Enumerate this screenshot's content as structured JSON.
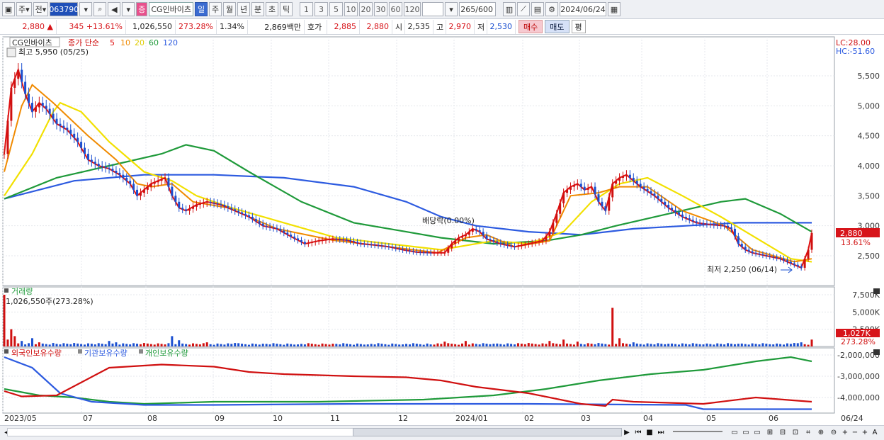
{
  "toolbar": {
    "mode_stock": "주",
    "prev": "전",
    "code": "063790",
    "stock_badge": "증",
    "stock_name": "CG인바이츠",
    "periods": [
      "일",
      "주",
      "월",
      "년",
      "분",
      "초",
      "틱"
    ],
    "active_period": "일",
    "intervals": [
      "1",
      "3",
      "5",
      "10",
      "20",
      "30",
      "60",
      "120"
    ],
    "count": "265",
    "count_max": "/600",
    "date": "2024/06/24"
  },
  "infobar": {
    "price": "2,880 ▲",
    "change": "345 +13.61%",
    "volume": "1,026,550",
    "vol_ratio": "273.28%",
    "turnover": "1.34%",
    "amount": "2,869백만",
    "quote_label": "호가",
    "ask": "2,885",
    "bid": "2,880",
    "open_label": "시",
    "open": "2,535",
    "high_label": "고",
    "high": "2,970",
    "low_label": "저",
    "low": "2,530",
    "buy": "매수",
    "sell": "매도",
    "even": "평"
  },
  "price_panel": {
    "name": "CG인바이츠",
    "legend_prefix": "종가 단순",
    "ma": [
      {
        "label": "5",
        "color": "#e01010"
      },
      {
        "label": "10",
        "color": "#f08a00"
      },
      {
        "label": "20",
        "color": "#f2e000"
      },
      {
        "label": "60",
        "color": "#1f9a3a"
      },
      {
        "label": "120",
        "color": "#2d5be0"
      }
    ],
    "high_note": "최고 5,950 (05/25)",
    "low_note": "최저 2,250 (06/14)",
    "dividend_note": "배당락(0.00%)",
    "lc": "LC:28.00",
    "hc": "HC:-51.60",
    "y_ticks": [
      "5,500",
      "5,000",
      "4,500",
      "4,000",
      "3,500",
      "3,000",
      "2,500"
    ],
    "last_price": "2,880",
    "last_change": "13.61%"
  },
  "volume_panel": {
    "title": "거래량",
    "info": "1,026,550주(273.28%)",
    "y_ticks": [
      "7,500K",
      "5,000K",
      "2,500K"
    ],
    "last_vol": "1,027K",
    "last_ratio": "273.28%"
  },
  "holdings_panel": {
    "legends": [
      {
        "label": "외국인보유수량",
        "color": "#d01010"
      },
      {
        "label": "기관보유수량",
        "color": "#2d5be0"
      },
      {
        "label": "개인보유수량",
        "color": "#1f9a3a"
      }
    ],
    "y_ticks": [
      "-2,000,000",
      "-3,000,000",
      "-4,000,000"
    ]
  },
  "x_axis": [
    "2023/05",
    "07",
    "08",
    "09",
    "10",
    "11",
    "12",
    "2024/01",
    "02",
    "03",
    "04",
    "05",
    "06",
    "06/24"
  ],
  "chart_data": {
    "type": "line",
    "price_range": [
      2200,
      5950
    ],
    "close_path": [
      [
        0,
        4200
      ],
      [
        2,
        5300
      ],
      [
        4,
        5600
      ],
      [
        6,
        5200
      ],
      [
        8,
        4900
      ],
      [
        10,
        5050
      ],
      [
        12,
        4950
      ],
      [
        15,
        4700
      ],
      [
        18,
        4600
      ],
      [
        21,
        4400
      ],
      [
        24,
        4100
      ],
      [
        27,
        4000
      ],
      [
        30,
        3950
      ],
      [
        33,
        3850
      ],
      [
        36,
        3700
      ],
      [
        38,
        3500
      ],
      [
        40,
        3600
      ],
      [
        42,
        3700
      ],
      [
        44,
        3750
      ],
      [
        46,
        3800
      ],
      [
        48,
        3500
      ],
      [
        50,
        3300
      ],
      [
        52,
        3250
      ],
      [
        55,
        3350
      ],
      [
        58,
        3400
      ],
      [
        62,
        3350
      ],
      [
        66,
        3250
      ],
      [
        70,
        3150
      ],
      [
        74,
        3000
      ],
      [
        78,
        2950
      ],
      [
        82,
        2820
      ],
      [
        86,
        2700
      ],
      [
        90,
        2750
      ],
      [
        94,
        2780
      ],
      [
        98,
        2760
      ],
      [
        102,
        2700
      ],
      [
        106,
        2680
      ],
      [
        110,
        2650
      ],
      [
        114,
        2600
      ],
      [
        118,
        2560
      ],
      [
        122,
        2550
      ],
      [
        126,
        2550
      ],
      [
        128,
        2700
      ],
      [
        130,
        2800
      ],
      [
        132,
        2850
      ],
      [
        134,
        2950
      ],
      [
        136,
        2900
      ],
      [
        138,
        2780
      ],
      [
        142,
        2700
      ],
      [
        146,
        2650
      ],
      [
        150,
        2700
      ],
      [
        154,
        2750
      ],
      [
        156,
        2900
      ],
      [
        158,
        3200
      ],
      [
        160,
        3550
      ],
      [
        162,
        3650
      ],
      [
        164,
        3700
      ],
      [
        166,
        3600
      ],
      [
        168,
        3650
      ],
      [
        170,
        3400
      ],
      [
        172,
        3250
      ],
      [
        174,
        3700
      ],
      [
        176,
        3800
      ],
      [
        178,
        3850
      ],
      [
        180,
        3750
      ],
      [
        182,
        3650
      ],
      [
        186,
        3500
      ],
      [
        190,
        3300
      ],
      [
        194,
        3150
      ],
      [
        198,
        3050
      ],
      [
        202,
        3020
      ],
      [
        206,
        3000
      ],
      [
        208,
        2950
      ],
      [
        210,
        2700
      ],
      [
        212,
        2600
      ],
      [
        214,
        2550
      ],
      [
        218,
        2500
      ],
      [
        222,
        2450
      ],
      [
        226,
        2350
      ],
      [
        228,
        2300
      ],
      [
        230,
        2600
      ],
      [
        231,
        2880
      ]
    ],
    "ma120_path": [
      [
        0,
        3450
      ],
      [
        20,
        3750
      ],
      [
        40,
        3850
      ],
      [
        60,
        3850
      ],
      [
        80,
        3800
      ],
      [
        100,
        3650
      ],
      [
        115,
        3400
      ],
      [
        125,
        3150
      ],
      [
        135,
        3000
      ],
      [
        150,
        2900
      ],
      [
        165,
        2850
      ],
      [
        180,
        2950
      ],
      [
        195,
        3000
      ],
      [
        210,
        3050
      ],
      [
        231,
        3050
      ]
    ],
    "ma60_path": [
      [
        0,
        3450
      ],
      [
        15,
        3800
      ],
      [
        30,
        4000
      ],
      [
        45,
        4200
      ],
      [
        52,
        4350
      ],
      [
        60,
        4250
      ],
      [
        70,
        3900
      ],
      [
        85,
        3400
      ],
      [
        100,
        3050
      ],
      [
        115,
        2900
      ],
      [
        125,
        2800
      ],
      [
        140,
        2700
      ],
      [
        155,
        2750
      ],
      [
        165,
        2850
      ],
      [
        175,
        3000
      ],
      [
        190,
        3200
      ],
      [
        205,
        3400
      ],
      [
        212,
        3450
      ],
      [
        222,
        3200
      ],
      [
        231,
        2900
      ]
    ],
    "ma20_path": [
      [
        0,
        3500
      ],
      [
        8,
        4200
      ],
      [
        14,
        4900
      ],
      [
        16,
        5050
      ],
      [
        22,
        4900
      ],
      [
        30,
        4400
      ],
      [
        40,
        3900
      ],
      [
        48,
        3750
      ],
      [
        55,
        3500
      ],
      [
        65,
        3300
      ],
      [
        80,
        3050
      ],
      [
        95,
        2800
      ],
      [
        110,
        2700
      ],
      [
        125,
        2600
      ],
      [
        140,
        2750
      ],
      [
        150,
        2700
      ],
      [
        160,
        2900
      ],
      [
        168,
        3400
      ],
      [
        176,
        3700
      ],
      [
        184,
        3800
      ],
      [
        194,
        3500
      ],
      [
        205,
        3150
      ],
      [
        215,
        2800
      ],
      [
        225,
        2450
      ],
      [
        231,
        2400
      ]
    ],
    "ma10_path": [
      [
        0,
        3900
      ],
      [
        5,
        5000
      ],
      [
        8,
        5350
      ],
      [
        14,
        5050
      ],
      [
        24,
        4500
      ],
      [
        32,
        4100
      ],
      [
        38,
        3700
      ],
      [
        42,
        3650
      ],
      [
        48,
        3700
      ],
      [
        54,
        3400
      ],
      [
        64,
        3300
      ],
      [
        78,
        2950
      ],
      [
        94,
        2760
      ],
      [
        110,
        2650
      ],
      [
        124,
        2550
      ],
      [
        132,
        2800
      ],
      [
        138,
        2850
      ],
      [
        146,
        2650
      ],
      [
        156,
        2750
      ],
      [
        162,
        3500
      ],
      [
        170,
        3550
      ],
      [
        176,
        3650
      ],
      [
        184,
        3650
      ],
      [
        194,
        3250
      ],
      [
        206,
        3000
      ],
      [
        214,
        2600
      ],
      [
        226,
        2400
      ],
      [
        231,
        2450
      ]
    ],
    "volume": [
      [
        0,
        7.5
      ],
      [
        1,
        1.0
      ],
      [
        2,
        2.5
      ],
      [
        3,
        1.5
      ],
      [
        5,
        0.8
      ],
      [
        8,
        1.2
      ],
      [
        10,
        0.6
      ],
      [
        14,
        0.5
      ],
      [
        20,
        0.5
      ],
      [
        25,
        0.4
      ],
      [
        30,
        0.8
      ],
      [
        32,
        0.6
      ],
      [
        40,
        0.5
      ],
      [
        48,
        1.5
      ],
      [
        50,
        0.9
      ],
      [
        58,
        0.6
      ],
      [
        66,
        0.5
      ],
      [
        74,
        0.4
      ],
      [
        84,
        0.3
      ],
      [
        94,
        0.4
      ],
      [
        104,
        0.3
      ],
      [
        114,
        0.3
      ],
      [
        122,
        0.3
      ],
      [
        126,
        0.7
      ],
      [
        132,
        0.8
      ],
      [
        140,
        0.4
      ],
      [
        150,
        0.5
      ],
      [
        156,
        0.8
      ],
      [
        160,
        1.0
      ],
      [
        164,
        0.7
      ],
      [
        170,
        0.5
      ],
      [
        174,
        5.6
      ],
      [
        176,
        1.2
      ],
      [
        180,
        0.6
      ],
      [
        190,
        0.4
      ],
      [
        200,
        0.3
      ],
      [
        210,
        0.4
      ],
      [
        220,
        0.3
      ],
      [
        226,
        0.5
      ],
      [
        228,
        0.6
      ],
      [
        231,
        1.0
      ]
    ],
    "foreign": [
      [
        0,
        -3.7
      ],
      [
        5,
        -3.95
      ],
      [
        15,
        -3.9
      ],
      [
        30,
        -2.6
      ],
      [
        45,
        -2.45
      ],
      [
        60,
        -2.55
      ],
      [
        70,
        -2.8
      ],
      [
        80,
        -2.9
      ],
      [
        90,
        -2.95
      ],
      [
        100,
        -3.0
      ],
      [
        115,
        -3.05
      ],
      [
        125,
        -3.2
      ],
      [
        135,
        -3.5
      ],
      [
        150,
        -3.8
      ],
      [
        165,
        -4.3
      ],
      [
        172,
        -4.4
      ],
      [
        174,
        -4.1
      ],
      [
        180,
        -4.2
      ],
      [
        200,
        -4.3
      ],
      [
        215,
        -4.0
      ],
      [
        231,
        -4.2
      ]
    ],
    "institution": [
      [
        0,
        -2.1
      ],
      [
        8,
        -2.6
      ],
      [
        16,
        -3.8
      ],
      [
        25,
        -4.2
      ],
      [
        40,
        -4.35
      ],
      [
        60,
        -4.35
      ],
      [
        100,
        -4.3
      ],
      [
        150,
        -4.3
      ],
      [
        195,
        -4.35
      ],
      [
        200,
        -4.55
      ],
      [
        231,
        -4.55
      ]
    ],
    "individual": [
      [
        0,
        -3.6
      ],
      [
        10,
        -3.9
      ],
      [
        20,
        -4.0
      ],
      [
        30,
        -4.2
      ],
      [
        40,
        -4.3
      ],
      [
        60,
        -4.2
      ],
      [
        90,
        -4.2
      ],
      [
        120,
        -4.1
      ],
      [
        140,
        -3.9
      ],
      [
        155,
        -3.6
      ],
      [
        170,
        -3.2
      ],
      [
        185,
        -2.9
      ],
      [
        200,
        -2.7
      ],
      [
        215,
        -2.3
      ],
      [
        225,
        -2.1
      ],
      [
        231,
        -2.3
      ]
    ]
  }
}
